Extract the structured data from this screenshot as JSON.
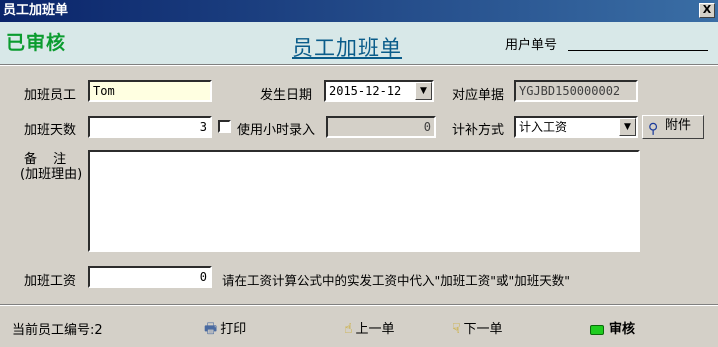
{
  "window": {
    "title": "员工加班单",
    "close_label": "X"
  },
  "header": {
    "stamp": "已审核",
    "title": "员工加班单",
    "user_doc_no_label": "用户单号"
  },
  "form": {
    "employee": {
      "label": "加班员工",
      "value": "Tom"
    },
    "date": {
      "label": "发生日期",
      "value": "2015-12-12"
    },
    "ref_no": {
      "label": "对应单据",
      "value": "YGJBD150000002"
    },
    "days": {
      "label": "加班天数",
      "value": "3"
    },
    "hourly": {
      "label": "使用小时录入",
      "value": "0",
      "checked": false
    },
    "comp_method": {
      "label": "计补方式",
      "value": "计入工资"
    },
    "attachment_label": "附件",
    "remark": {
      "label_line1": "备    注",
      "label_line2": "(加班理由)",
      "value": ""
    },
    "wage": {
      "label": "加班工资",
      "value": "0",
      "hint": "请在工资计算公式中的实发工资中代入\"加班工资\"或\"加班天数\""
    }
  },
  "footer": {
    "employee_no": "当前员工编号:2",
    "print_label": "打印",
    "prev_label": "上一单",
    "next_label": "下一单",
    "audit_label": "审核"
  }
}
